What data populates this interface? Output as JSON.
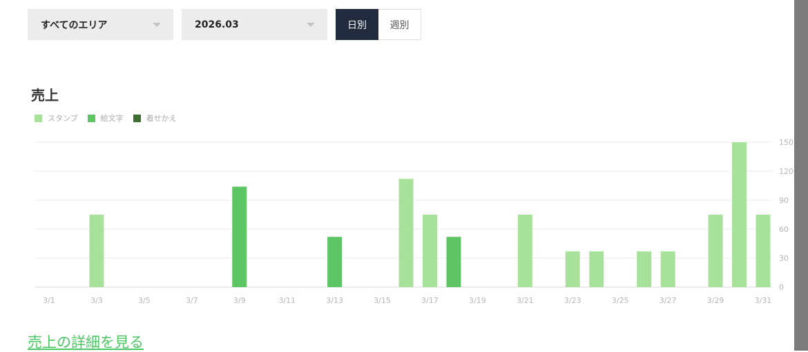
{
  "filters": {
    "area": {
      "value": "すべてのエリア"
    },
    "month": {
      "value": "2026.03"
    },
    "period": {
      "daily_label": "日別",
      "weekly_label": "週別",
      "selected": "daily"
    }
  },
  "detail_link": "売上の詳細を見る",
  "colors": {
    "stamp": "#a8e29a",
    "emoji": "#5ec565",
    "theme": "#3e6f2e",
    "link": "#4cc764"
  },
  "chart_data": {
    "type": "bar",
    "title": "売上",
    "legend": [
      "スタンプ",
      "絵文字",
      "着せかえ"
    ],
    "legend_position": "top-left",
    "grid": true,
    "ylim": [
      0,
      150
    ],
    "yticks": [
      0,
      30,
      60,
      90,
      120,
      150
    ],
    "y_axis_side": "right",
    "categories": [
      "3/1",
      "3/2",
      "3/3",
      "3/4",
      "3/5",
      "3/6",
      "3/7",
      "3/8",
      "3/9",
      "3/10",
      "3/11",
      "3/12",
      "3/13",
      "3/14",
      "3/15",
      "3/16",
      "3/17",
      "3/18",
      "3/19",
      "3/20",
      "3/21",
      "3/22",
      "3/23",
      "3/24",
      "3/25",
      "3/26",
      "3/27",
      "3/28",
      "3/29",
      "3/30",
      "3/31"
    ],
    "xtick_labels": [
      "3/1",
      "3/3",
      "3/5",
      "3/7",
      "3/9",
      "3/11",
      "3/13",
      "3/15",
      "3/17",
      "3/19",
      "3/21",
      "3/23",
      "3/25",
      "3/27",
      "3/29",
      "3/31"
    ],
    "series": [
      {
        "name": "スタンプ",
        "color": "#a8e29a",
        "values": [
          0,
          0,
          75,
          0,
          0,
          0,
          0,
          0,
          0,
          0,
          0,
          0,
          0,
          0,
          0,
          112,
          75,
          0,
          0,
          0,
          75,
          0,
          37,
          37,
          0,
          37,
          37,
          0,
          75,
          150,
          75
        ]
      },
      {
        "name": "絵文字",
        "color": "#5ec565",
        "values": [
          0,
          0,
          0,
          0,
          0,
          0,
          0,
          0,
          104,
          0,
          0,
          0,
          52,
          0,
          0,
          0,
          0,
          52,
          0,
          0,
          0,
          0,
          0,
          0,
          0,
          0,
          0,
          0,
          0,
          0,
          0
        ]
      },
      {
        "name": "着せかえ",
        "color": "#3e6f2e",
        "values": [
          0,
          0,
          0,
          0,
          0,
          0,
          0,
          0,
          0,
          0,
          0,
          0,
          0,
          0,
          0,
          0,
          0,
          0,
          0,
          0,
          0,
          0,
          0,
          0,
          0,
          0,
          0,
          0,
          0,
          0,
          0
        ]
      }
    ]
  }
}
